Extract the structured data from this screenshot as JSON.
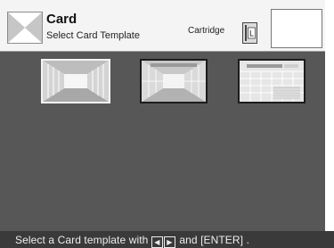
{
  "header": {
    "title": "Card",
    "subtitle": "Select Card Template",
    "cartridge_label": "Cartridge",
    "cartridge_size": "L"
  },
  "templates": [
    {
      "name": "corridor",
      "selected": true
    },
    {
      "name": "corridor-with-grid",
      "selected": false
    },
    {
      "name": "grid-tiles",
      "selected": false
    }
  ],
  "status": {
    "prefix": "Select a Card template with",
    "left_key": "◀",
    "right_key": "▶",
    "joiner": "and",
    "enter_key": "[ENTER]",
    "suffix": "."
  },
  "colors": {
    "main_bg": "#575757",
    "status_bg": "#3a3a3a",
    "header_bg": "#f4f4f4",
    "selected_border": "#f3f3f3"
  }
}
